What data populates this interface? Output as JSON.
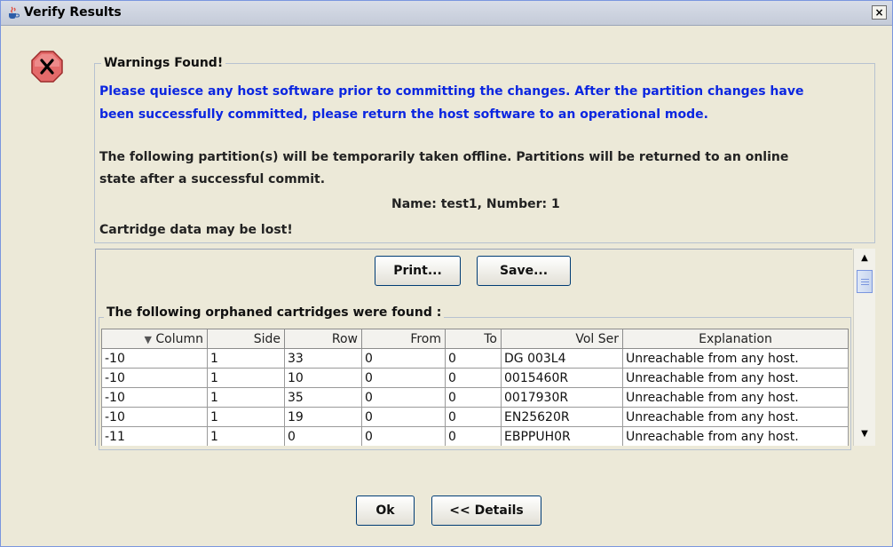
{
  "window": {
    "title": "Verify Results",
    "close_glyph": "×"
  },
  "warnings": {
    "heading": "Warnings Found!",
    "line1": "Please quiesce any host software prior to committing the changes. After the partition changes have",
    "line2": "been successfully committed, please return the host software to an operational mode.",
    "line3": "The following partition(s) will be temporarily taken offline. Partitions will be returned to an online",
    "line4": "state after a successful commit.",
    "partition": "Name: test1,  Number: 1",
    "data_loss": "Cartridge data may be lost!"
  },
  "actions": {
    "print": "Print...",
    "save": "Save..."
  },
  "orphans": {
    "heading": "The following orphaned cartridges were found :",
    "sort_indicator": "▼",
    "columns": [
      "Column",
      "Side",
      "Row",
      "From",
      "To",
      "Vol Ser",
      "Explanation"
    ],
    "rows": [
      [
        "-10",
        "1",
        "33",
        "0",
        "0",
        "DG 003L4",
        "Unreachable from any host."
      ],
      [
        "-10",
        "1",
        "10",
        "0",
        "0",
        "0015460R",
        "Unreachable from any host."
      ],
      [
        "-10",
        "1",
        "35",
        "0",
        "0",
        "0017930R",
        "Unreachable from any host."
      ],
      [
        "-10",
        "1",
        "19",
        "0",
        "0",
        "EN25620R",
        "Unreachable from any host."
      ],
      [
        "-11",
        "1",
        "0",
        "0",
        "0",
        "EBPPUH0R",
        "Unreachable from any host."
      ]
    ]
  },
  "footer": {
    "ok": "Ok",
    "details": "<< Details"
  },
  "icons": {
    "title": "java-cup-icon",
    "error": "error-stop-icon"
  },
  "colors": {
    "accent_text": "#0b26e0",
    "error_fill": "#e46a6a"
  }
}
